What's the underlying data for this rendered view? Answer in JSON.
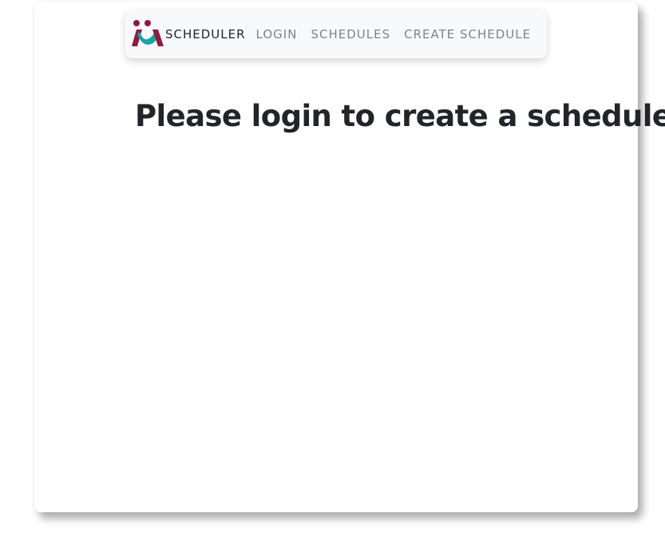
{
  "brand": {
    "logo_icon": "scheduler-logo-icon",
    "name": "SCHEDULER",
    "colors": {
      "primary": "#8c1d3f",
      "secondary": "#1aa3a7"
    }
  },
  "nav": {
    "items": [
      {
        "label": "LOGIN"
      },
      {
        "label": "SCHEDULES"
      },
      {
        "label": "CREATE SCHEDULE"
      }
    ]
  },
  "main": {
    "message": "Please login to create a schedule."
  }
}
